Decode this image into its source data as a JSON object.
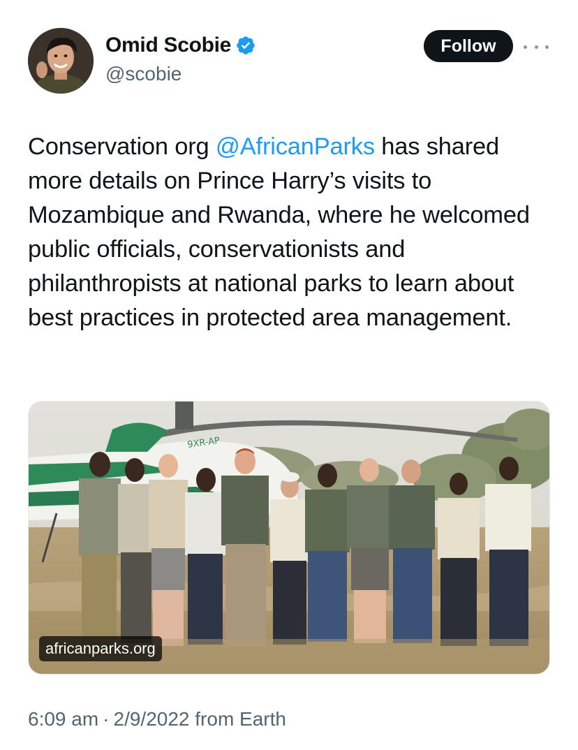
{
  "author": {
    "display_name": "Omid Scobie",
    "handle": "@scobie",
    "verified": true,
    "avatar_icon": "profile-photo",
    "verified_color": "#1d9bf0"
  },
  "actions": {
    "follow_label": "Follow",
    "more_icon": "ellipsis-icon"
  },
  "tweet": {
    "text_before": "Conservation org ",
    "mention": "@AfricanParks",
    "text_after": " has shared more details on Prince Harry’s visits to Mozambique and Rwanda, where he welcomed public officials, conservationists and philanthropists at national parks to learn about best practices in protected area management.",
    "mention_color": "#1d9bf0"
  },
  "media": {
    "link_label": "africanparks.org",
    "helicopter_registration": "9XR-AP"
  },
  "meta": {
    "time": "6:09 am",
    "separator": "·",
    "date": "2/9/2022",
    "source": "from Earth"
  }
}
